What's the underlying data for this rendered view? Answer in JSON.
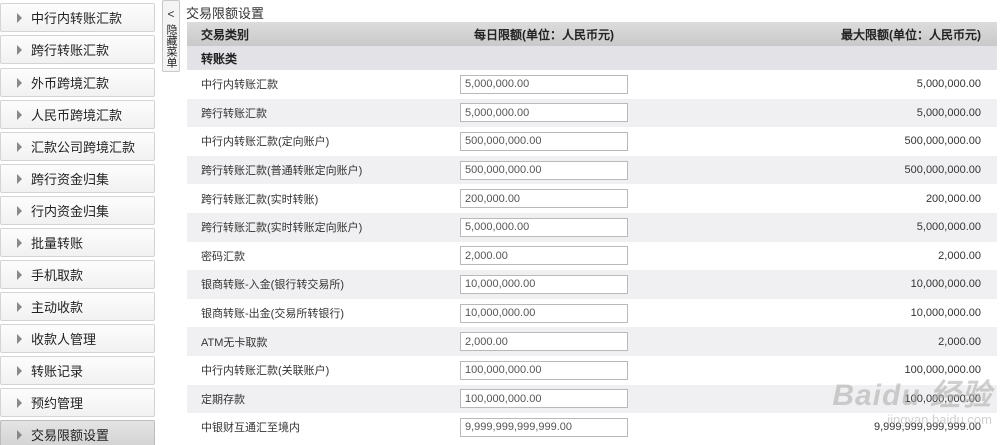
{
  "sidebar": {
    "items": [
      {
        "label": "中行内转账汇款"
      },
      {
        "label": "跨行转账汇款"
      },
      {
        "label": "外币跨境汇款"
      },
      {
        "label": "人民币跨境汇款"
      },
      {
        "label": "汇款公司跨境汇款"
      },
      {
        "label": "跨行资金归集"
      },
      {
        "label": "行内资金归集"
      },
      {
        "label": "批量转账"
      },
      {
        "label": "手机取款"
      },
      {
        "label": "主动收款"
      },
      {
        "label": "收款人管理"
      },
      {
        "label": "转账记录"
      },
      {
        "label": "预约管理"
      },
      {
        "label": "交易限额设置",
        "active": true
      }
    ]
  },
  "hide_menu": {
    "arrow": "<",
    "label": "隐藏菜单"
  },
  "page_title": "交易限额设置",
  "table": {
    "headers": {
      "type": "交易类别",
      "daily": "每日限额(单位：人民币元)",
      "max": "最大限额(单位：人民币元)"
    },
    "section_label": "转账类",
    "rows": [
      {
        "name": "中行内转账汇款",
        "daily": "5,000,000.00",
        "max": "5,000,000.00"
      },
      {
        "name": "跨行转账汇款",
        "daily": "5,000,000.00",
        "max": "5,000,000.00"
      },
      {
        "name": "中行内转账汇款(定向账户)",
        "daily": "500,000,000.00",
        "max": "500,000,000.00"
      },
      {
        "name": "跨行转账汇款(普通转账定向账户)",
        "daily": "500,000,000.00",
        "max": "500,000,000.00"
      },
      {
        "name": "跨行转账汇款(实时转账)",
        "daily": "200,000.00",
        "max": "200,000.00"
      },
      {
        "name": "跨行转账汇款(实时转账定向账户)",
        "daily": "5,000,000.00",
        "max": "5,000,000.00"
      },
      {
        "name": "密码汇款",
        "daily": "2,000.00",
        "max": "2,000.00"
      },
      {
        "name": "银商转账-入金(银行转交易所)",
        "daily": "10,000,000.00",
        "max": "10,000,000.00"
      },
      {
        "name": "银商转账-出金(交易所转银行)",
        "daily": "10,000,000.00",
        "max": "10,000,000.00"
      },
      {
        "name": "ATM无卡取款",
        "daily": "2,000.00",
        "max": "2,000.00"
      },
      {
        "name": "中行内转账汇款(关联账户)",
        "daily": "100,000,000.00",
        "max": "100,000,000.00"
      },
      {
        "name": "定期存款",
        "daily": "100,000,000.00",
        "max": "100,000,000.00"
      },
      {
        "name": "中银财互通汇至境内",
        "daily": "9,999,999,999,999.00",
        "max": "9,999,999,999,999.00"
      }
    ]
  },
  "watermark": {
    "logo": "Baidu 经验",
    "url": "jingyan.baidu.com"
  }
}
